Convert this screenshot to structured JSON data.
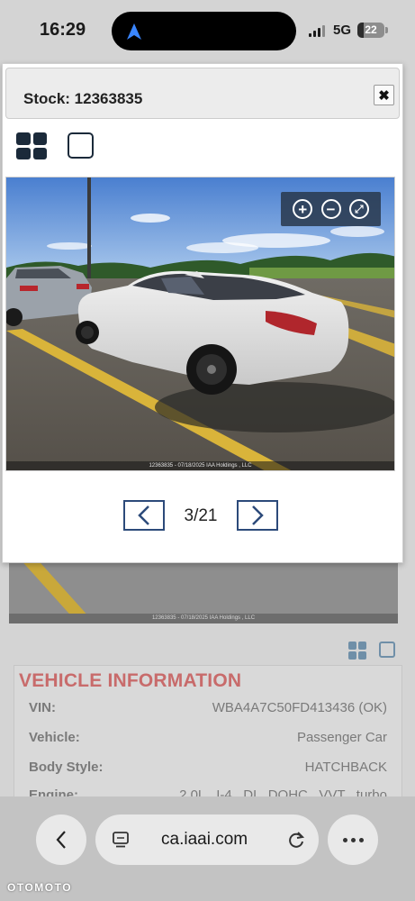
{
  "status_bar": {
    "time": "16:29",
    "network": "5G",
    "battery": "22",
    "battery_level": 0.22
  },
  "modal": {
    "title": "Stock: 12363835",
    "close_label": "✖",
    "photo_caption": "12363835 - 07/18/2025 IAA Holdings , LLC",
    "pager": {
      "current": 3,
      "total": 21,
      "count_text": "3/21"
    }
  },
  "background": {
    "photo_caption": "12363835 - 07/18/2025 IAA Holdings , LLC",
    "section_title": "VEHICLE INFORMATION",
    "rows": [
      {
        "key": "VIN:",
        "value": "WBA4A7C50FD413436 (OK)"
      },
      {
        "key": "Vehicle:",
        "value": "Passenger Car"
      },
      {
        "key": "Body Style:",
        "value": "HATCHBACK"
      },
      {
        "key": "Engine:",
        "value": "2.0L   I-4   DI   DOHC   VVT   turbo"
      }
    ]
  },
  "browser": {
    "url": "ca.iaai.com"
  },
  "watermark": "OTOMOTO",
  "colors": {
    "accent": "#2c4a7a",
    "section_title": "#c86b6b",
    "icon_dark": "#1b2a3a"
  }
}
